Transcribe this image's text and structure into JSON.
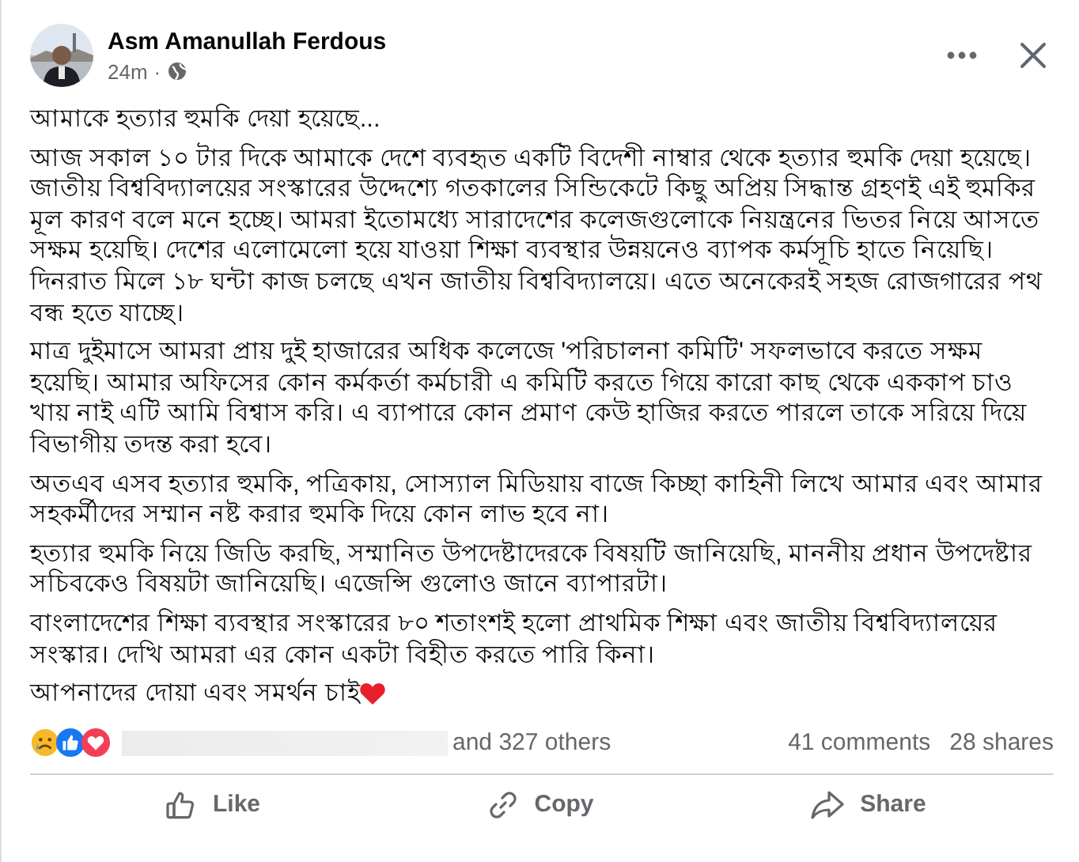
{
  "post": {
    "author": "Asm Amanullah Ferdous",
    "time": "24m",
    "separator": "·",
    "paragraphs": [
      "আমাকে হত্যার হুমকি দেয়া হয়েছে...",
      "আজ সকাল ১০ টার দিকে আমাকে দেশে ব্যবহৃত একটি বিদেশী নাম্বার থেকে হত্যার হুমকি দেয়া হয়েছে। জাতীয় বিশ্ববিদ্যালয়ের সংস্কারের উদ্দেশ্যে গতকালের সিন্ডিকেটে কিছু অপ্রিয় সিদ্ধান্ত গ্রহণই এই হুমকির মূল কারণ বলে মনে হচ্ছে। আমরা ইতোমধ্যে সারাদেশের কলেজগুলোকে নিয়ন্ত্রনের ভিতর নিয়ে আসতে সক্ষম হয়েছি। দেশের এলোমেলো হয়ে যাওয়া শিক্ষা ব্যবস্থার উন্নয়নেও ব্যাপক কর্মসূচি হাতে নিয়েছি। দিনরাত মিলে ১৮ ঘন্টা কাজ চলছে এখন জাতীয় বিশ্ববিদ্যালয়ে। এতে অনেকেরই সহজ রোজগারের পথ বন্ধ হতে যাচ্ছে।",
      "মাত্র দুইমাসে আমরা প্রায় দুই হাজারের অধিক কলেজে 'পরিচালনা কমিটি' সফলভাবে করতে সক্ষম হয়েছি। আমার অফিসের কোন কর্মকর্তা কর্মচারী এ কমিটি করতে গিয়ে কারো কাছ থেকে এককাপ  চাও খায় নাই এটি আমি বিশ্বাস করি। এ ব্যাপারে কোন প্রমাণ কেউ হাজির করতে পারলে তাকে সরিয়ে দিয়ে বিভাগীয় তদন্ত করা হবে।",
      "অতএব এসব হত্যার হুমকি, পত্রিকায়, সোস্যাল মিডিয়ায় বাজে কিচ্ছা কাহিনী লিখে আমার এবং আমার সহকর্মীদের সম্মান নষ্ট করার হুমকি দিয়ে কোন লাভ হবে না।",
      "হত্যার হুমকি নিয়ে জিডি করছি, সম্মানিত উপদেষ্টাদেরকে বিষয়টি জানিয়েছি, মাননীয় প্রধান উপদেষ্টার সচিবকেও বিষয়টা জানিয়েছি। এজেন্সি গুলোও জানে ব্যাপারটা।",
      "বাংলাদেশের শিক্ষা ব্যবস্থার সংস্কারের ৮০ শতাংশই হলো প্রাথমিক শিক্ষা এবং জাতীয় বিশ্ববিদ্যালয়ের সংস্কার। দেখি আমরা এর কোন একটা বিহীত করতে পারি কিনা।",
      "আপনাদের দোয়া এবং সমর্থন চাই"
    ]
  },
  "reactions": {
    "others": "and 327 others",
    "comments": "41 comments",
    "shares": "28 shares"
  },
  "actions": [
    {
      "label": "Like",
      "kind": "like"
    },
    {
      "label": "Copy",
      "kind": "copy"
    },
    {
      "label": "Share",
      "kind": "share"
    }
  ]
}
